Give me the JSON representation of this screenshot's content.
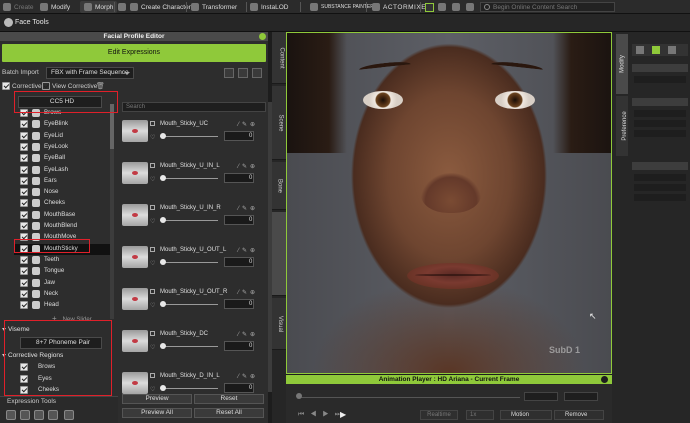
{
  "toolbar": {
    "items": [
      {
        "label": "Create",
        "active": false,
        "dim": true
      },
      {
        "label": "Modify",
        "active": false
      },
      {
        "label": "Morph",
        "active": true
      },
      {
        "label": "Create Character"
      },
      {
        "label": "Transformer"
      },
      {
        "label": "InstaLOD"
      },
      {
        "label": "SUBSTANCE PAINTER"
      },
      {
        "label": "ACTORMIXER"
      }
    ],
    "search_placeholder": "Begin Online Content Search"
  },
  "facetools": {
    "label": "Face Tools"
  },
  "facial_editor": {
    "title": "Facial Profile Editor",
    "edit_expressions_label": "Edit Expressions",
    "batch_import_label": "Batch Import",
    "batch_import_value": "FBX with Frame Sequence",
    "corrective_label": "Corrective",
    "view_corrective_label": "View Corrective",
    "profile_value": "CC5 HD",
    "search_placeholder": "Search",
    "regions": [
      "Brows",
      "EyeBlink",
      "EyeLid",
      "EyeLook",
      "EyeBall",
      "EyeLash",
      "Ears",
      "Nose",
      "Cheeks",
      "MouthBase",
      "MouthBlend",
      "MouthMove",
      "MouthSticky",
      "Teeth",
      "Tongue",
      "Jaw",
      "Neck",
      "Head"
    ],
    "selected_region": "MouthSticky",
    "new_slider_label": "New Slider",
    "viseme_label": "Viseme",
    "phoneme_value": "8+7 Phoneme Pair",
    "corrective_regions_label": "Corrective Regions",
    "corrective_regions": [
      "Brows",
      "Eyes",
      "Cheeks"
    ],
    "sliders": [
      {
        "name": "Mouth_Sticky_UC",
        "value": "0"
      },
      {
        "name": "Mouth_Sticky_U_IN_L",
        "value": "0"
      },
      {
        "name": "Mouth_Sticky_U_IN_R",
        "value": "0"
      },
      {
        "name": "Mouth_Sticky_U_OUT_L",
        "value": "0"
      },
      {
        "name": "Mouth_Sticky_U_OUT_R",
        "value": "0"
      },
      {
        "name": "Mouth_Sticky_DC",
        "value": "0"
      },
      {
        "name": "Mouth_Sticky_D_IN_L",
        "value": "0"
      }
    ],
    "preview_label": "Preview",
    "reset_label": "Reset",
    "preview_all_label": "Preview All",
    "reset_all_label": "Reset All",
    "expression_tools_label": "Expression Tools"
  },
  "side_tabs": [
    "Content",
    "Scene",
    "Bone",
    "Facial Profile Editor",
    "Visual"
  ],
  "right_tabs": [
    "Modify",
    "Preference"
  ],
  "viewport": {
    "watermark": "SubD 1"
  },
  "anim_player": {
    "title": "Animation Player : HD Ariana - Current Frame",
    "realtime_label": "Realtime",
    "speed_value": "1x",
    "motion_label": "Motion",
    "remove_label": "Remove"
  },
  "colors": {
    "accent": "#8fc93a",
    "annotation": "#e0202a"
  }
}
